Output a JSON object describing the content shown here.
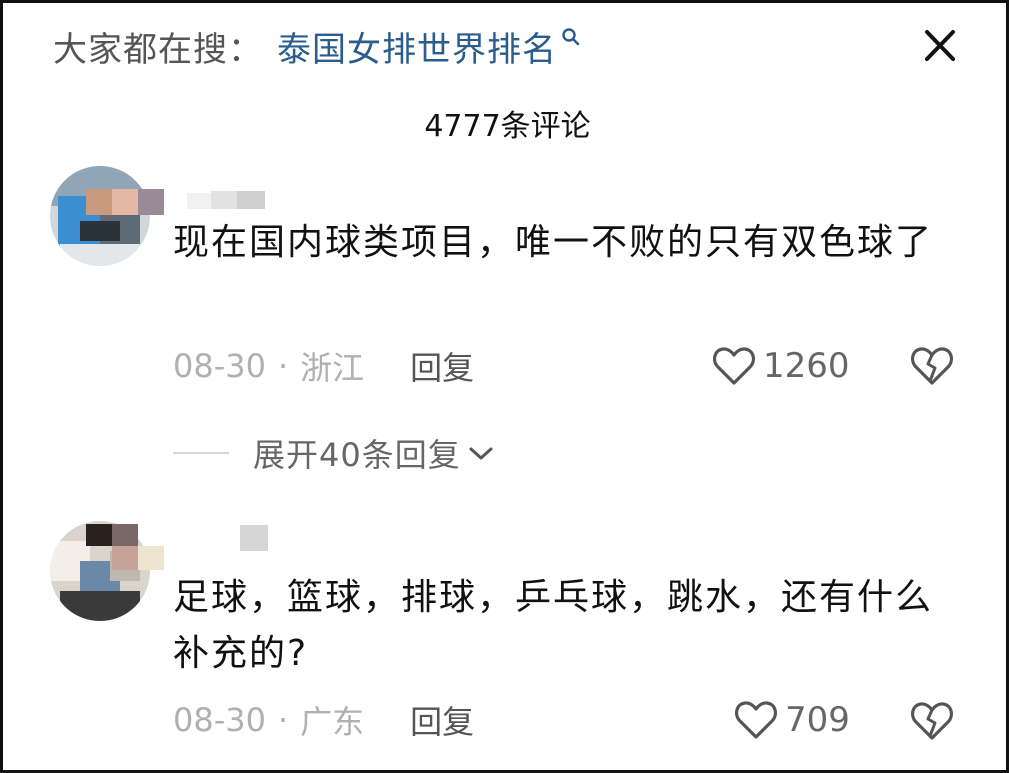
{
  "search": {
    "prefix": "大家都在搜：",
    "term": "泰国女排世界排名",
    "search_icon": "search-icon",
    "close_icon": "close-icon"
  },
  "comment_count": "4777条评论",
  "comments": [
    {
      "text": "现在国内球类项目，唯一不败的只有双色球了",
      "date": "08-30",
      "separator": "·",
      "location": "浙江",
      "reply_label": "回复",
      "likes": "1260",
      "like_icon": "heart-outline-icon",
      "dislike_icon": "broken-heart-icon",
      "expand_label": "展开40条回复",
      "expand_icon": "chevron-down-icon"
    },
    {
      "text": "足球，篮球，排球，乒乓球，跳水，还有什么补充的?",
      "date": "08-30",
      "separator": "·",
      "location": "广东",
      "reply_label": "回复",
      "likes": "709",
      "like_icon": "heart-outline-icon",
      "dislike_icon": "broken-heart-icon"
    }
  ],
  "colors": {
    "search_term": "#2a5c8c",
    "meta_text": "#b0b0b0",
    "body_text": "#111111"
  }
}
